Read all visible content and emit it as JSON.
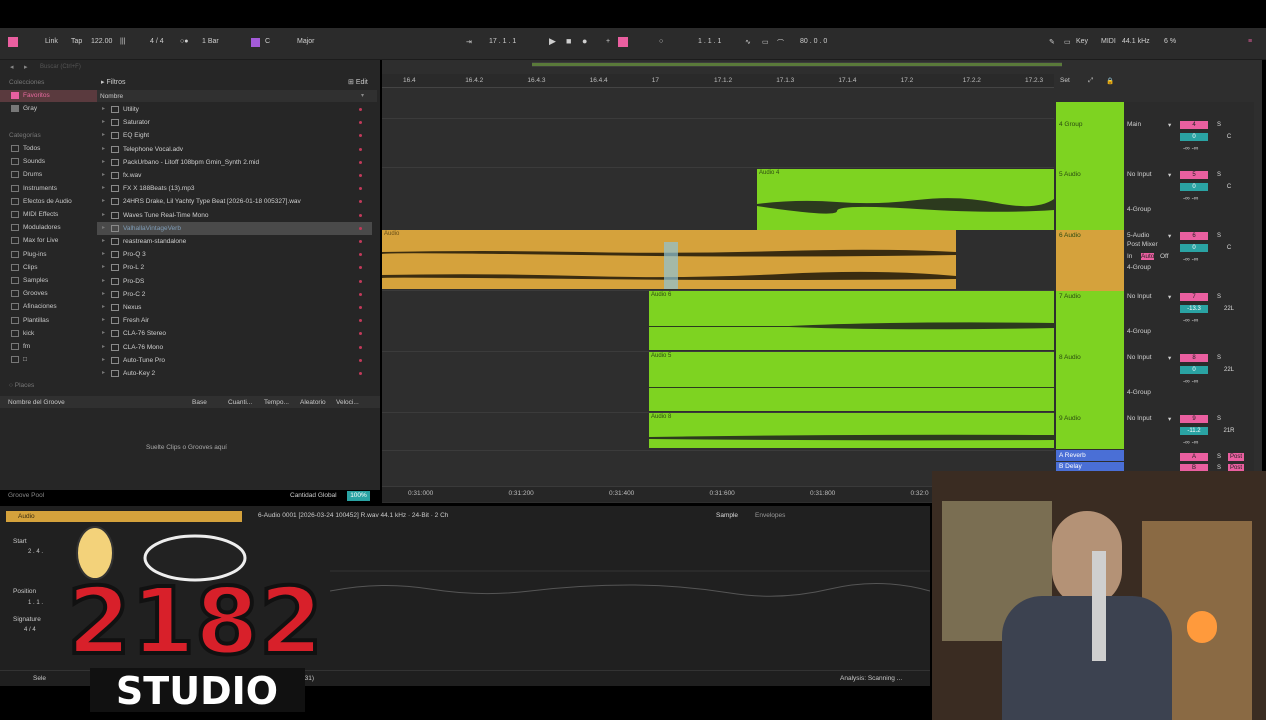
{
  "topbar": {
    "link": "Link",
    "tap": "Tap",
    "tempo": "122.00",
    "signature": "4 / 4",
    "quantize": "1 Bar",
    "key_root": "C",
    "scale": "Major",
    "position": "17 .  1 .  1",
    "loop_start": "1 .  1 .  1",
    "loop_length": "80 .  0 .  0",
    "key_label": "Key",
    "midi_label": "MIDI",
    "sample_rate": "44.1 kHz",
    "cpu": "6 %"
  },
  "browser": {
    "search_placeholder": "Buscar (Ctrl+F)",
    "filters": "Filtros",
    "edit": "Edit",
    "collections_header": "Colecciones",
    "collections": [
      "Favoritos",
      "Gray"
    ],
    "categories_header": "Categorías",
    "categories": [
      "Todos",
      "Sounds",
      "Drums",
      "Instruments",
      "Efectos de Audio",
      "MIDI Effects",
      "Moduladores",
      "Max for Live",
      "Plug-ins",
      "Clips",
      "Samples",
      "Grooves",
      "Afinaciones",
      "Plantillas",
      "kick",
      "fm",
      "□"
    ],
    "places": "Places",
    "name_header": "Nombre",
    "files": [
      "Utility",
      "Saturator",
      "EQ Eight",
      "Telephone Vocal.adv",
      "PackUrbano - Litoff 108bpm Gmin_Synth 2.mid",
      "fx.wav",
      "FX X 188Beats (13).mp3",
      "24HRS Drake, Lil Yachty Type Beat [2026-01-18 005327].wav",
      "Waves Tune Real-Time Mono",
      "ValhallaVintageVerb",
      "reastream-standalone",
      "Pro-Q 3",
      "Pro-L 2",
      "Pro-DS",
      "Pro-C 2",
      "Nexus",
      "Fresh Air",
      "CLA-76 Stereo",
      "CLA-76 Mono",
      "Auto-Tune Pro",
      "Auto-Key 2"
    ]
  },
  "groove": {
    "columns": [
      "Nombre del Groove",
      "Base",
      "Cuanti...",
      "Tempo...",
      "Aleatorio",
      "Veloci..."
    ],
    "empty": "Suelte Clips o Grooves aquí",
    "pool": "Groove Pool",
    "global_label": "Cantidad Global",
    "global_value": "100%"
  },
  "ruler": {
    "ticks": [
      "16.4",
      "16.4.2",
      "16.4.3",
      "16.4.4",
      "17",
      "17.1.2",
      "17.1.3",
      "17.1.4",
      "17.2",
      "17.2.2",
      "17.2.3"
    ],
    "set": "Set"
  },
  "timebar": {
    "ticks": [
      "0:31:000",
      "0:31:200",
      "0:31:400",
      "0:31:600",
      "0:31:800",
      "0:32:0"
    ]
  },
  "tracks": [
    {
      "name": "4 Group",
      "input": "Main",
      "num": "4",
      "pan": "C"
    },
    {
      "name": "5 Audio",
      "input": "No Input",
      "output": "4-Group",
      "num": "5",
      "pan": "C"
    },
    {
      "name": "6 Audio",
      "input": "5-Audio",
      "monitor": "Post Mixer",
      "output": "4-Group",
      "num": "6",
      "pan": "C",
      "in": "In",
      "auto": "Auto",
      "off": "Off"
    },
    {
      "name": "7 Audio",
      "input": "No Input",
      "output": "4-Group",
      "num": "7",
      "vol": "-13.3",
      "pan": "22L"
    },
    {
      "name": "8 Audio",
      "input": "No Input",
      "output": "4-Group",
      "num": "8",
      "pan": "22L"
    },
    {
      "name": "9 Audio",
      "input": "No Input",
      "num": "9",
      "vol": "-11.2",
      "pan": "21R"
    },
    {
      "name": "A Reverb",
      "num": "A",
      "post": "Post"
    },
    {
      "name": "B Delay",
      "num": "B",
      "post": "Post"
    }
  ],
  "clips": {
    "audio4": "Audio 4",
    "audio": "Audio",
    "audio6": "Audio 6",
    "audio5": "Audio 5",
    "audio8": "Audio 8"
  },
  "detail": {
    "clip_name": "Audio",
    "file_info": "6-Audio 0001 [2026-03-24 100452] R.wav  44.1 kHz · 24-Bit · 2 Ch",
    "tab_sample": "Sample",
    "tab_envelopes": "Envelopes",
    "start_label": "Start",
    "start_value": "2 .  4 .",
    "position_label": "Position",
    "position_value": "1 .  1 .",
    "signature_label": "Signature",
    "signature_value": "4 / 4",
    "status_left": "Sele",
    "status_time": "(.00:031)",
    "status_right": "Analysis: Scanning ..."
  },
  "logo": {
    "text_top": "2182",
    "text_bottom": "STUDIO"
  },
  "colors": {
    "green": "#7ed321",
    "orange": "#d5a23c",
    "pink": "#ea5fa0",
    "cyan": "#2aa3a3"
  }
}
